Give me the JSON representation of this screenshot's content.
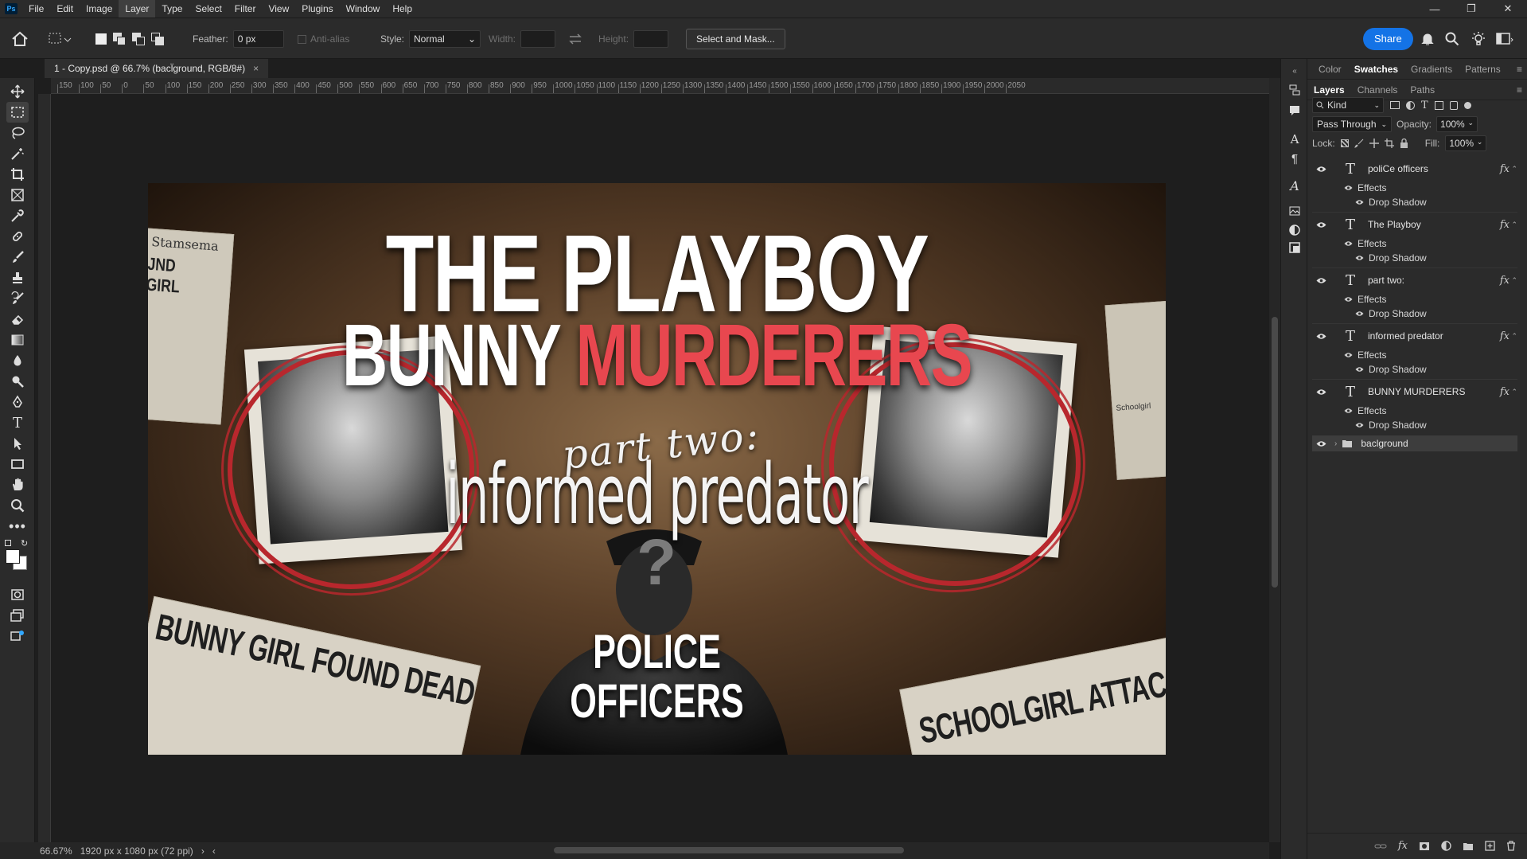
{
  "menu": [
    "File",
    "Edit",
    "Image",
    "Layer",
    "Type",
    "Select",
    "Filter",
    "View",
    "Plugins",
    "Window",
    "Help"
  ],
  "menu_active": "Layer",
  "app_logo": "Ps",
  "options": {
    "feather_label": "Feather:",
    "feather_value": "0 px",
    "antialias_label": "Anti-alias",
    "style_label": "Style:",
    "style_value": "Normal",
    "width_label": "Width:",
    "height_label": "Height:",
    "select_mask": "Select and Mask...",
    "share": "Share"
  },
  "document": {
    "tab_title": "1 - Copy.psd @ 66.7% (bacl̈ground, RGB/8#)",
    "close": "×"
  },
  "ruler_labels": [
    "150",
    "100",
    "50",
    "0",
    "50",
    "100",
    "150",
    "200",
    "250",
    "300",
    "350",
    "400",
    "450",
    "500",
    "550",
    "600",
    "650",
    "700",
    "750",
    "800",
    "850",
    "900",
    "950",
    "1000",
    "1050",
    "1100",
    "1150",
    "1200",
    "1250",
    "1300",
    "1350",
    "1400",
    "1450",
    "1500",
    "1550",
    "1600",
    "1650",
    "1700",
    "1750",
    "1800",
    "1850",
    "1900",
    "1950",
    "2000",
    "2050"
  ],
  "artwork": {
    "title_line1": "THE PLAYBOY",
    "title_line2a": "BUNNY",
    "title_line2b": "MURDERERS",
    "part_two": "part two:",
    "subtitle": "informed predator",
    "police_line1": "POLICE",
    "police_line2": "OFFICERS",
    "question": "?",
    "headline_left": "BUNNY GIRL FOUND DEAD",
    "headline_right": "SCHOOLGIRL ATTAC",
    "paper_left_top": "Stamsema",
    "paper_left_head": "JND GIRL",
    "paper_right_small": "Schoolgirl",
    "accent_red": "#e8474f",
    "ring_red": "#b8272d"
  },
  "status": {
    "zoom": "66.67%",
    "info": "1920 px x 1080 px (72 ppi)"
  },
  "panels": {
    "top_tabs": [
      "Color",
      "Swatches",
      "Gradients",
      "Patterns"
    ],
    "top_active": "Swatches",
    "layer_tabs": [
      "Layers",
      "Channels",
      "Paths"
    ],
    "layer_active": "Layers",
    "kind": "Kind",
    "blend": "Pass Through",
    "opacity_label": "Opacity:",
    "opacity_value": "100%",
    "lock_label": "Lock:",
    "fill_label": "Fill:",
    "fill_value": "100%",
    "effects_label": "Effects",
    "drop_shadow_label": "Drop Shadow",
    "fx": "fx",
    "text_layers": [
      "poliCe  officers",
      "The Playboy",
      "part two:",
      "informed predator",
      "BUNNY MURDERERS"
    ],
    "group_layer": "baclground"
  }
}
